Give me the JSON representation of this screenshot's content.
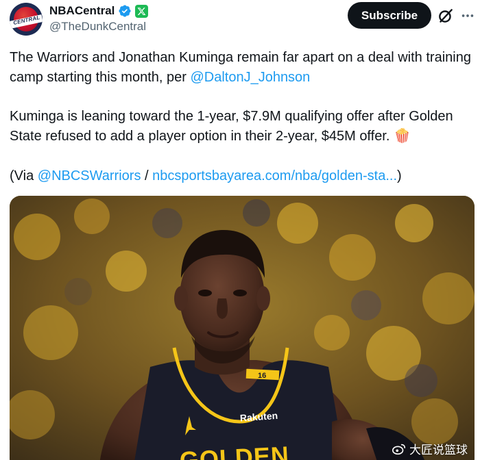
{
  "author": {
    "display_name": "NBACentral",
    "handle": "@TheDunkCentral",
    "avatar_text": "CENTRAL",
    "verified_icon": "verified-badge-icon",
    "affiliate_icon": "x-affiliate-badge-icon"
  },
  "actions": {
    "subscribe_label": "Subscribe",
    "grok_icon": "grok-icon",
    "more_icon": "more-icon"
  },
  "tweet": {
    "p1_text": "The Warriors and Jonathan Kuminga remain far apart on a deal with training camp starting this month, per ",
    "p1_mention": "@DaltonJ_Johnson",
    "p2_text": "Kuminga is leaning toward the 1-year, $7.9M qualifying offer after Golden State refused to add a player option in their 2-year, $45M offer. ",
    "p2_emoji": "🍿",
    "p3_prefix": "(Via ",
    "p3_mention": "@NBCSWarriors",
    "p3_sep": " / ",
    "p3_link": "nbcsportsbayarea.com/nba/golden-sta...",
    "p3_suffix": ")"
  },
  "media": {
    "jersey_number": "16",
    "jersey_sponsor": "Rakuten",
    "jersey_wordmark": "GOLDEN",
    "watermark": "大匠说篮球"
  },
  "colors": {
    "link": "#1d9bf0",
    "verified": "#1d9bf0",
    "affiliate": "#1dba55",
    "subscribe_bg": "#0f1419",
    "warriors_gold": "#f5c518",
    "jersey": "#1a1c2a"
  }
}
